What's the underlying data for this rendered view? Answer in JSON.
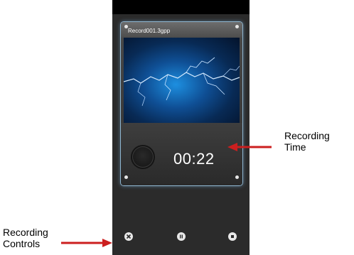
{
  "recorder": {
    "filename": "Record001.3gpp",
    "elapsed_time": "00:22"
  },
  "controls": [
    {
      "name": "discard",
      "icon": "close-icon"
    },
    {
      "name": "pause",
      "icon": "pause-icon"
    },
    {
      "name": "stop",
      "icon": "stop-icon"
    }
  ],
  "annotations": {
    "time_label_line1": "Recording",
    "time_label_line2": "Time",
    "controls_label_line1": "Recording",
    "controls_label_line2": "Controls"
  },
  "colors": {
    "arrow": "#cc1f1f",
    "card_glow": "#8fb6d0",
    "screen_bg": "#2b2b2b"
  }
}
